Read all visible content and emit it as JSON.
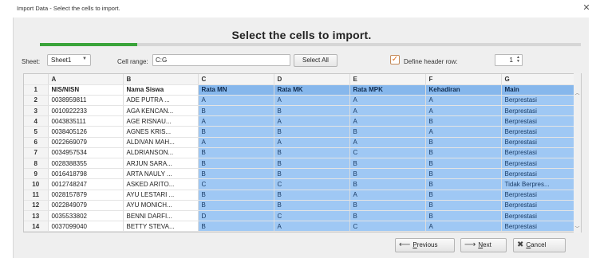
{
  "window": {
    "title": "Import Data - Select the cells to import.",
    "close_icon": "close-icon"
  },
  "heading": "Select the cells to import.",
  "progress": {
    "fraction": 0.18,
    "color": "#3aa43a"
  },
  "toolbar": {
    "sheet_label": "Sheet:",
    "sheet_value": "Sheet1",
    "cell_range_label": "Cell range:",
    "cell_range_value": "C:G",
    "select_all_label": "Select All",
    "define_header_label": "Define header row:",
    "define_header_checked": true,
    "header_row_value": "1"
  },
  "grid": {
    "columns": [
      "A",
      "B",
      "C",
      "D",
      "E",
      "F",
      "G"
    ],
    "rows": [
      {
        "n": "1",
        "cells": [
          "NIS/NISN",
          "Nama Siswa",
          "Rata MN",
          "Rata MK",
          "Rata MPK",
          "Kehadiran",
          "Main"
        ]
      },
      {
        "n": "2",
        "cells": [
          "0038959811",
          "ADE PUTRA ...",
          "A",
          "A",
          "A",
          "A",
          "Berprestasi"
        ]
      },
      {
        "n": "3",
        "cells": [
          "0010922233",
          "AGA KENCAN...",
          "B",
          "B",
          "A",
          "A",
          "Berprestasi"
        ]
      },
      {
        "n": "4",
        "cells": [
          "0043835111",
          "AGE RISNAU...",
          "A",
          "A",
          "A",
          "B",
          "Berprestasi"
        ]
      },
      {
        "n": "5",
        "cells": [
          "0038405126",
          "AGNES KRIS...",
          "B",
          "B",
          "B",
          "A",
          "Berprestasi"
        ]
      },
      {
        "n": "6",
        "cells": [
          "0022669079",
          "ALDIVAN MAH...",
          "A",
          "A",
          "A",
          "B",
          "Berprestasi"
        ]
      },
      {
        "n": "7",
        "cells": [
          "0034957534",
          "ALDRIANSON...",
          "B",
          "B",
          "C",
          "B",
          "Berprestasi"
        ]
      },
      {
        "n": "8",
        "cells": [
          "0028388355",
          "ARJUN SARA...",
          "B",
          "B",
          "B",
          "B",
          "Berprestasi"
        ]
      },
      {
        "n": "9",
        "cells": [
          "0016418798",
          "ARTA NAULY ...",
          "B",
          "B",
          "B",
          "B",
          "Berprestasi"
        ]
      },
      {
        "n": "10",
        "cells": [
          "0012748247",
          "ASKED ARITO...",
          "C",
          "C",
          "B",
          "B",
          "Tidak Berpres..."
        ]
      },
      {
        "n": "11",
        "cells": [
          "0028157879",
          "AYU LESTARI ...",
          "B",
          "B",
          "A",
          "B",
          "Berprestasi"
        ]
      },
      {
        "n": "12",
        "cells": [
          "0022849079",
          "AYU MONICH...",
          "B",
          "B",
          "B",
          "B",
          "Berprestasi"
        ]
      },
      {
        "n": "13",
        "cells": [
          "0035533802",
          "BENNI DARFI...",
          "D",
          "C",
          "B",
          "B",
          "Berprestasi"
        ]
      },
      {
        "n": "14",
        "cells": [
          "0037099040",
          "BETTY STEVA...",
          "B",
          "A",
          "C",
          "A",
          "Berprestasi"
        ]
      }
    ],
    "selected_columns": [
      2,
      3,
      4,
      5,
      6
    ]
  },
  "footer": {
    "previous_label_pre": "",
    "previous_label_u": "P",
    "previous_label_post": "revious",
    "next_label_u": "N",
    "next_label_post": "ext",
    "cancel_label_u": "C",
    "cancel_label_post": "ancel"
  }
}
